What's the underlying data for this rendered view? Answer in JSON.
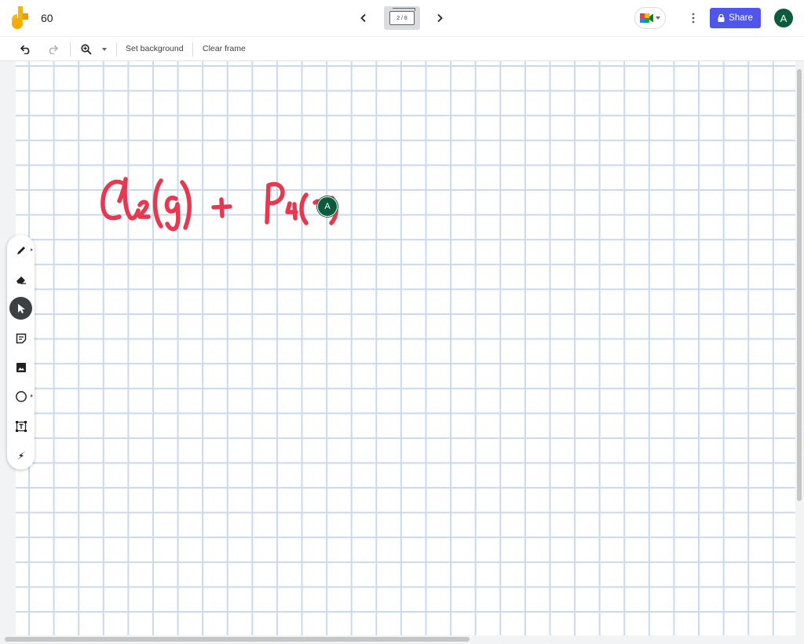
{
  "header": {
    "title": "60",
    "frame_indicator": "2 / 8",
    "share_label": "Share",
    "user_initial": "A"
  },
  "toolbar": {
    "set_background_label": "Set background",
    "clear_frame_label": "Clear frame"
  },
  "canvas": {
    "collaborator_initial": "A",
    "ink_color": "#e8384f",
    "grid_color": "#c9d9ee"
  },
  "tools": [
    {
      "icon": "pen-icon",
      "active": false
    },
    {
      "icon": "eraser-icon",
      "active": false
    },
    {
      "icon": "select-arrow-icon",
      "active": true
    },
    {
      "icon": "sticky-note-icon",
      "active": false
    },
    {
      "icon": "image-icon",
      "active": false
    },
    {
      "icon": "circle-shape-icon",
      "active": false
    },
    {
      "icon": "text-box-icon",
      "active": false
    },
    {
      "icon": "laser-pointer-icon",
      "active": false
    }
  ],
  "colors": {
    "accent": "#4f56e8",
    "avatar": "#0b5c3d",
    "logo_yellow": "#fbbc04"
  }
}
